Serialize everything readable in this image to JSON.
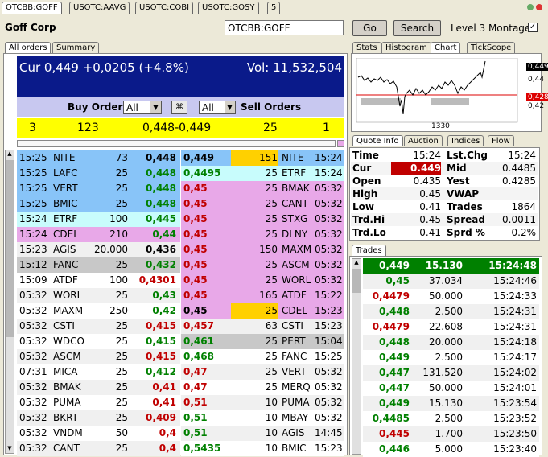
{
  "symbol_tabs": [
    "OTCBB:GOFF",
    "USOTC:AAVG",
    "USOTC:COBI",
    "USOTC:GOSY",
    "5"
  ],
  "company": "Goff Corp",
  "symbol_input": "OTCBB:GOFF",
  "go_label": "Go",
  "search_label": "Search",
  "level3_label": "Level 3 Montage",
  "left_tabs": [
    "All orders",
    "Summary"
  ],
  "header": {
    "cur": "Cur 0,449 +0,0205 (+4.8%)",
    "vol": "Vol: 11,532,504"
  },
  "order_controls": {
    "buy_label": "Buy Orders",
    "sell_label": "Sell Orders",
    "buy_filter": "All",
    "sell_filter": "All"
  },
  "summary": {
    "bid_count": "3",
    "bid_size": "123",
    "spread": "0,448-0,449",
    "ask_size": "25",
    "ask_count": "1"
  },
  "bids": [
    {
      "time": "15:25",
      "mm": "NITE",
      "size": "73",
      "price": "0,448"
    },
    {
      "time": "15:25",
      "mm": "LAFC",
      "size": "25",
      "price": "0,448"
    },
    {
      "time": "15:25",
      "mm": "VERT",
      "size": "25",
      "price": "0,448"
    },
    {
      "time": "15:25",
      "mm": "BMIC",
      "size": "25",
      "price": "0,448"
    },
    {
      "time": "15:24",
      "mm": "ETRF",
      "size": "100",
      "price": "0,445"
    },
    {
      "time": "15:24",
      "mm": "CDEL",
      "size": "210",
      "price": "0,44"
    },
    {
      "time": "15:23",
      "mm": "AGIS",
      "size": "20.000",
      "price": "0,436"
    },
    {
      "time": "15:12",
      "mm": "FANC",
      "size": "25",
      "price": "0,432"
    },
    {
      "time": "15:09",
      "mm": "ATDF",
      "size": "100",
      "price": "0,4301"
    },
    {
      "time": "05:32",
      "mm": "WORL",
      "size": "25",
      "price": "0,43"
    },
    {
      "time": "05:32",
      "mm": "MAXM",
      "size": "250",
      "price": "0,42"
    },
    {
      "time": "05:32",
      "mm": "CSTI",
      "size": "25",
      "price": "0,415"
    },
    {
      "time": "05:32",
      "mm": "WDCO",
      "size": "25",
      "price": "0,415"
    },
    {
      "time": "05:32",
      "mm": "ASCM",
      "size": "25",
      "price": "0,415"
    },
    {
      "time": "07:31",
      "mm": "MICA",
      "size": "25",
      "price": "0,412"
    },
    {
      "time": "05:32",
      "mm": "BMAK",
      "size": "25",
      "price": "0,41"
    },
    {
      "time": "05:32",
      "mm": "PUMA",
      "size": "25",
      "price": "0,41"
    },
    {
      "time": "05:32",
      "mm": "BKRT",
      "size": "25",
      "price": "0,409"
    },
    {
      "time": "05:32",
      "mm": "VNDM",
      "size": "50",
      "price": "0,4"
    },
    {
      "time": "05:32",
      "mm": "CANT",
      "size": "25",
      "price": "0,4"
    }
  ],
  "asks": [
    {
      "price": "0,449",
      "size": "151",
      "mm": "NITE",
      "time": "15:24"
    },
    {
      "price": "0,4495",
      "size": "25",
      "mm": "ETRF",
      "time": "15:24"
    },
    {
      "price": "0,45",
      "size": "25",
      "mm": "BMAK",
      "time": "05:32"
    },
    {
      "price": "0,45",
      "size": "25",
      "mm": "CANT",
      "time": "05:32"
    },
    {
      "price": "0,45",
      "size": "25",
      "mm": "STXG",
      "time": "05:32"
    },
    {
      "price": "0,45",
      "size": "25",
      "mm": "DLNY",
      "time": "05:32"
    },
    {
      "price": "0,45",
      "size": "150",
      "mm": "MAXM",
      "time": "05:32"
    },
    {
      "price": "0,45",
      "size": "25",
      "mm": "ASCM",
      "time": "05:32"
    },
    {
      "price": "0,45",
      "size": "25",
      "mm": "WORL",
      "time": "05:32"
    },
    {
      "price": "0,45",
      "size": "165",
      "mm": "ATDF",
      "time": "15:22"
    },
    {
      "price": "0,45",
      "size": "25",
      "mm": "CDEL",
      "time": "15:23"
    },
    {
      "price": "0,457",
      "size": "63",
      "mm": "CSTI",
      "time": "15:23"
    },
    {
      "price": "0,461",
      "size": "25",
      "mm": "PERT",
      "time": "15:04"
    },
    {
      "price": "0,468",
      "size": "25",
      "mm": "FANC",
      "time": "15:25"
    },
    {
      "price": "0,47",
      "size": "25",
      "mm": "VERT",
      "time": "05:32"
    },
    {
      "price": "0,47",
      "size": "25",
      "mm": "MERQ",
      "time": "05:32"
    },
    {
      "price": "0,51",
      "size": "10",
      "mm": "PUMA",
      "time": "05:32"
    },
    {
      "price": "0,51",
      "size": "10",
      "mm": "MBAY",
      "time": "05:32"
    },
    {
      "price": "0,51",
      "size": "10",
      "mm": "AGIS",
      "time": "14:45"
    },
    {
      "price": "0,5435",
      "size": "10",
      "mm": "BMIC",
      "time": "15:23"
    }
  ],
  "chart_tabs": [
    "Stats",
    "Histogram",
    "Chart",
    "TickScope"
  ],
  "chart": {
    "labels": [
      "0,449",
      "0,44",
      "0,43",
      "0,4285",
      "0,42"
    ],
    "xlabel": "1330"
  },
  "info_tabs": [
    "Quote Info",
    "Auction",
    "Indices",
    "Flow"
  ],
  "quote_info": [
    {
      "l": "Time",
      "lv": "15:24",
      "r": "Lst.Chg",
      "rv": "15:24"
    },
    {
      "l": "Cur",
      "lv": "0.449",
      "r": "Mid",
      "rv": "0.4485"
    },
    {
      "l": "Open",
      "lv": "0.435",
      "r": "Yest",
      "rv": "0.4285"
    },
    {
      "l": "High",
      "lv": "0.45",
      "r": "VWAP",
      "rv": ""
    },
    {
      "l": "Low",
      "lv": "0.41",
      "r": "Trades",
      "rv": "1864"
    },
    {
      "l": "Trd.Hi",
      "lv": "0.45",
      "r": "Spread",
      "rv": "0.0011"
    },
    {
      "l": "Trd.Lo",
      "lv": "0.41",
      "r": "Sprd %",
      "rv": "0.2%"
    }
  ],
  "trades_tab": "Trades",
  "trades": [
    {
      "price": "0,449",
      "size": "15.130",
      "time": "15:24:48",
      "color": "#008000"
    },
    {
      "price": "0,45",
      "size": "37.034",
      "time": "15:24:46",
      "color": "#008000"
    },
    {
      "price": "0,4479",
      "size": "50.000",
      "time": "15:24:33",
      "color": "#c00000"
    },
    {
      "price": "0,448",
      "size": "2.500",
      "time": "15:24:31",
      "color": "#008000"
    },
    {
      "price": "0,4479",
      "size": "22.608",
      "time": "15:24:31",
      "color": "#c00000"
    },
    {
      "price": "0,448",
      "size": "20.000",
      "time": "15:24:18",
      "color": "#008000"
    },
    {
      "price": "0,449",
      "size": "2.500",
      "time": "15:24:17",
      "color": "#008000"
    },
    {
      "price": "0,447",
      "size": "131.520",
      "time": "15:24:02",
      "color": "#008000"
    },
    {
      "price": "0,447",
      "size": "50.000",
      "time": "15:24:01",
      "color": "#008000"
    },
    {
      "price": "0,449",
      "size": "15.130",
      "time": "15:23:54",
      "color": "#008000"
    },
    {
      "price": "0,4485",
      "size": "2.500",
      "time": "15:23:52",
      "color": "#008000"
    },
    {
      "price": "0,445",
      "size": "1.700",
      "time": "15:23:50",
      "color": "#c00000"
    },
    {
      "price": "0,446",
      "size": "5.000",
      "time": "15:23:40",
      "color": "#008000"
    }
  ]
}
